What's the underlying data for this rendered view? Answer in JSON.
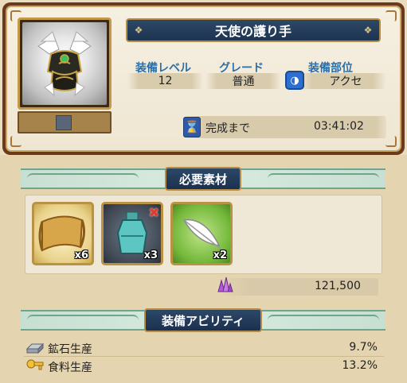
{
  "item": {
    "name": "天使の護り手",
    "image_icon": "angel-armor-icon"
  },
  "stats": {
    "level_label": "装備レベル",
    "level_value": "12",
    "grade_label": "グレード",
    "grade_value": "普通",
    "slot_label": "装備部位",
    "slot_value": "アクセ",
    "slot_icon": "accessory-icon"
  },
  "timer": {
    "label": "完成まで",
    "value": "03:41:02",
    "icon": "hourglass-icon"
  },
  "materials": {
    "title": "必要素材",
    "items": [
      {
        "icon": "scroll-icon",
        "count": "x6",
        "missing": false
      },
      {
        "icon": "potion-bottle-icon",
        "count": "x3",
        "missing": true
      },
      {
        "icon": "white-feather-icon",
        "count": "x2",
        "missing": false
      }
    ],
    "cost_icon": "purple-crystal-icon",
    "cost_value": "121,500"
  },
  "abilities": {
    "title": "装備アビリティ",
    "items": [
      {
        "icon": "iron-ingot-icon",
        "label": "鉱石生産",
        "value": "9.7%"
      },
      {
        "icon": "golden-key-icon",
        "label": "食料生産",
        "value": "13.2%"
      }
    ]
  },
  "colors": {
    "frame_brown": "#6b3a1c",
    "banner_navy": "#1e3450",
    "label_blue": "#2b6ea8",
    "band_green": "#6fa58a",
    "missing_red": "#e23a2e"
  }
}
